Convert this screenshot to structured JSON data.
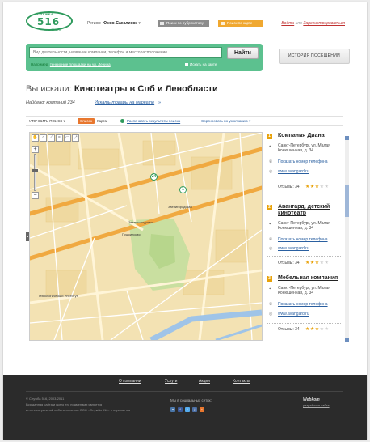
{
  "header": {
    "logo": {
      "top_word": "СЛУЖБА",
      "number": "516",
      "site": "www.516.ru"
    },
    "region_label": "Регион:",
    "region_value": "Южно-Сахалинск",
    "region_caret": "▾",
    "btn_rubricator": "Поиск по рубрикатору",
    "btn_map": "Поиск по карте",
    "login": "Войти",
    "or": "или",
    "register": "Зарегистрироваться"
  },
  "search": {
    "placeholder": "Вид деятельности, название компании, телефон и месторасположение",
    "button": "Найти",
    "example_label": "Например:",
    "example_text": "теннисные площадки на ул. Ленина",
    "map_checkbox": "Искать на карте",
    "history_button": "ИСТОРИЯ ПОСЕЩЕНИЙ"
  },
  "results_header": {
    "prefix": "Вы искали:",
    "query": "Кинотеатры в Спб и Ленобласти",
    "found": "Найдено: компаний 234",
    "goods_link": "Искать товары на маркете",
    "goods_arrow": "»"
  },
  "toolbar": {
    "refine": "УТОЧНИТЬ ПОИСК ▾",
    "list": "Список",
    "map": "Карта",
    "print": "Распечатать результаты поиска",
    "sort": "Сортировать по умолчанию ▾"
  },
  "map": {
    "labels": [
      "Звенигородская",
      "Пушкинская",
      "Звенигородская",
      "Технологический Институт"
    ],
    "pins": [
      "24",
      "1"
    ],
    "collapse": "◂"
  },
  "listings": [
    {
      "num": "1",
      "name": "Компания Диана",
      "address": "Санкт-Петербург, ул. Малая Конюшенная, д. 34",
      "phone": "Показать номер телефона",
      "site": "www.avangard.ru",
      "reviews": "Отзывы: 34",
      "stars": 3
    },
    {
      "num": "2",
      "name": "Авангард, детский кинотеатр",
      "address": "Санкт-Петербург, ул. Малая Конюшенная, д. 34",
      "phone": "Показать номер телефона",
      "site": "www.avangard.ru",
      "reviews": "Отзывы: 34",
      "stars": 3
    },
    {
      "num": "3",
      "name": "Мебельная компания",
      "address": "Санкт-Петербург, ул. Малая Конюшенная, д. 34",
      "phone": "Показать номер телефона",
      "site": "www.avangard.ru",
      "reviews": "Отзывы: 34",
      "stars": 3
    }
  ],
  "footer": {
    "nav": [
      "О компании",
      "Услуги",
      "Акции",
      "Контакты"
    ],
    "copyright": "© Служба 516, 2003-2011",
    "legal1": "Вся данная сайта и всего его подменами является",
    "legal2": "интеллектуальной собственностью ООО «Служба 516» и охраняется",
    "social_label": "Мы в социальных сетях:",
    "social_icons": [
      {
        "name": "vk-icon",
        "glyph": "в",
        "color": "#4a76a8"
      },
      {
        "name": "facebook-icon",
        "glyph": "f",
        "color": "#3b5998"
      },
      {
        "name": "twitter-icon",
        "glyph": "t",
        "color": "#55acee"
      },
      {
        "name": "livejournal-icon",
        "glyph": "j",
        "color": "#4c6fa5"
      },
      {
        "name": "rss-icon",
        "glyph": "r",
        "color": "#e8772e"
      }
    ],
    "webkom": "Webkom",
    "webkom_sub": "разработка сайта"
  }
}
